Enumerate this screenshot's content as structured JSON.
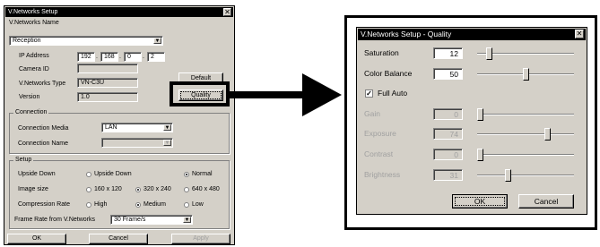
{
  "setup_window": {
    "title": "V.Networks Setup",
    "close_glyph": "✕",
    "name_label": "V.Networks Name",
    "name_value": "Reception",
    "ip_label": "IP Address",
    "ip": [
      "192",
      "168",
      "0",
      "2"
    ],
    "camera_id_label": "Camera ID",
    "camera_id_value": "",
    "type_label": "V.Networks Type",
    "type_value": "VN-C3U",
    "version_label": "Version",
    "version_value": "1.0",
    "default_button": "Default",
    "quality_button": "Quality",
    "connection": {
      "group_label": "Connection",
      "media_label": "Connection Media",
      "media_value": "LAN",
      "name_label": "Connection Name",
      "name_value": ""
    },
    "setup": {
      "group_label": "Setup",
      "upside_label": "Upside Down",
      "upside_options": [
        "Upside Down",
        "Normal"
      ],
      "upside_selected": "Normal",
      "image_label": "Image size",
      "image_options": [
        "160 x 120",
        "320 x 240",
        "640 x 480"
      ],
      "image_selected": "320 x 240",
      "compression_label": "Compression Rate",
      "compression_options": [
        "High",
        "Medium",
        "Low"
      ],
      "compression_selected": "Medium",
      "frame_label": "Frame Rate from V.Networks",
      "frame_value": "30 Frame/s"
    },
    "buttons": {
      "ok": "OK",
      "cancel": "Cancel",
      "apply": "Apply"
    }
  },
  "quality_window": {
    "title": "V.Networks Setup - Quality",
    "close_glyph": "✕",
    "saturation": {
      "label": "Saturation",
      "value": "12",
      "level": 0.1
    },
    "color_balance": {
      "label": "Color Balance",
      "value": "50",
      "level": 0.5
    },
    "full_auto": {
      "label": "Full Auto",
      "checked": true
    },
    "gain": {
      "label": "Gain",
      "value": "0",
      "level": 0.0
    },
    "exposure": {
      "label": "Exposure",
      "value": "74",
      "level": 0.74
    },
    "contrast": {
      "label": "Contrast",
      "value": "0",
      "level": 0.0
    },
    "brightness": {
      "label": "Brightness",
      "value": "31",
      "level": 0.31
    },
    "buttons": {
      "ok": "OK",
      "cancel": "Cancel"
    }
  },
  "colors": {
    "titlebar": "#000000",
    "face": "#d4d0c8",
    "highlight_box": "#000000"
  }
}
